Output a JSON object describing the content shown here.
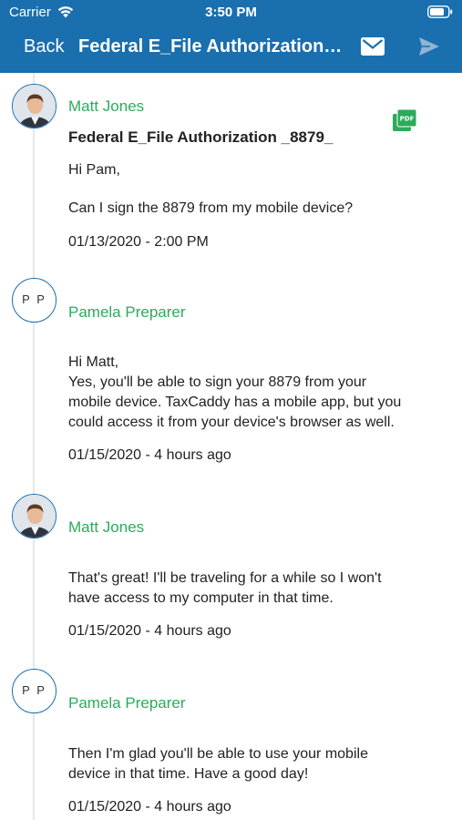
{
  "status_bar": {
    "carrier": "Carrier",
    "time": "3:50 PM",
    "wifi_icon": "wifi-icon",
    "battery_icon": "battery-icon"
  },
  "nav": {
    "back_label": "Back",
    "title": "Federal E_File Authorization _8879_",
    "mail_icon": "mail-icon",
    "send_icon": "send-icon"
  },
  "colors": {
    "header_bg": "#1a6fae",
    "sender_name": "#2bab5b",
    "attachment": "#2bab5b"
  },
  "messages": [
    {
      "sender": "Matt Jones",
      "avatar": "photo",
      "subject": "Federal E_File Authorization _8879_",
      "attachment_icon": "pdf-icon",
      "greeting": "Hi Pam,",
      "body": "Can I sign the 8879 from my mobile device?",
      "timestamp": "01/13/2020 - 2:00 PM"
    },
    {
      "sender": "Pamela Preparer",
      "initials": "PP",
      "body_lines": [
        "Hi Matt,",
        "Yes, you'll be able to sign your 8879 from your",
        "mobile device. TaxCaddy has a mobile app, but you",
        "could access it from your device's browser as well."
      ],
      "timestamp": "01/15/2020 - 4 hours ago"
    },
    {
      "sender": "Matt Jones",
      "avatar": "photo",
      "body_lines": [
        "That's great! I'll be traveling for a while so I won't",
        "have access to my computer in that time."
      ],
      "timestamp": "01/15/2020 - 4 hours ago"
    },
    {
      "sender": "Pamela Preparer",
      "initials": "PP",
      "body_lines": [
        "Then I'm glad you'll be able to use your mobile",
        "device in that time. Have a good day!"
      ],
      "timestamp": "01/15/2020 - 4 hours ago"
    }
  ]
}
